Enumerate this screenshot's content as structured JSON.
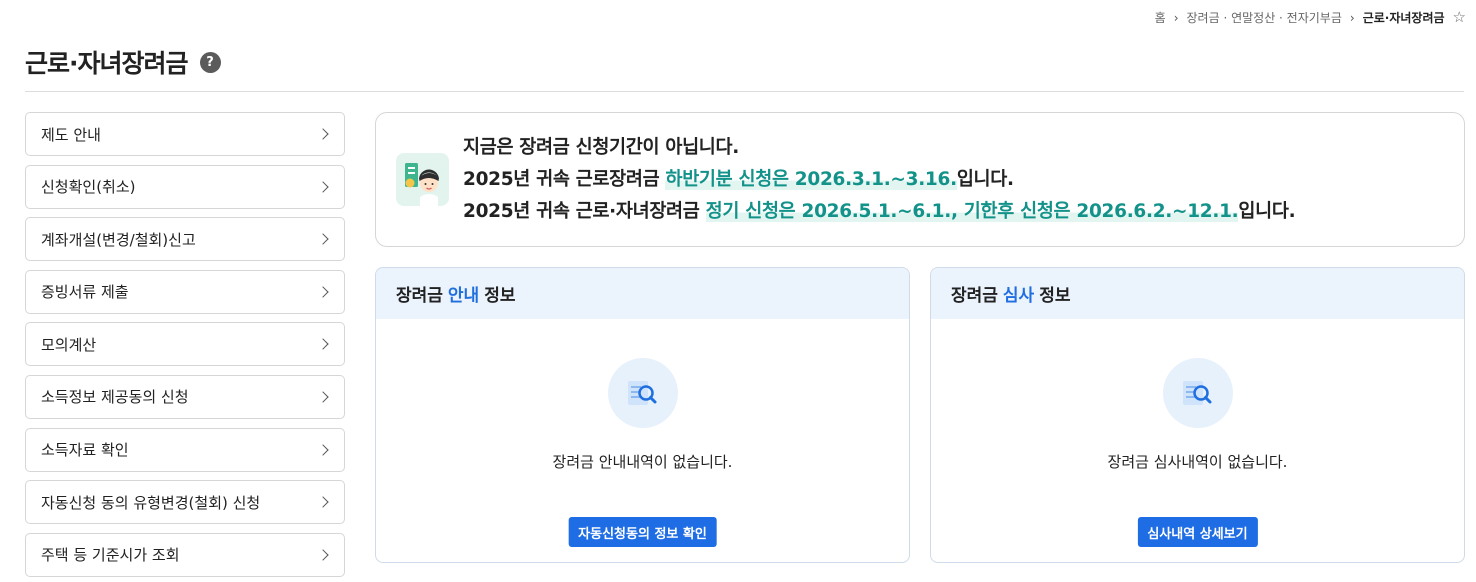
{
  "breadcrumb": {
    "home": "홈",
    "level1": "장려금 · 연말정산 · 전자기부금",
    "current": "근로·자녀장려금",
    "star_icon": "star-outline-icon"
  },
  "page": {
    "title": "근로·자녀장려금",
    "help_glyph": "?"
  },
  "sidebar": {
    "items": [
      {
        "label": "제도 안내"
      },
      {
        "label": "신청확인(취소)"
      },
      {
        "label": "계좌개설(변경/철회)신고"
      },
      {
        "label": "증빙서류 제출"
      },
      {
        "label": "모의계산"
      },
      {
        "label": "소득정보 제공동의 신청"
      },
      {
        "label": "소득자료 확인"
      },
      {
        "label": "자동신청 동의 유형변경(철회) 신청"
      },
      {
        "label": "주택 등 기준시가 조회"
      }
    ]
  },
  "notice": {
    "line1": "지금은 장려금 신청기간이 아닙니다.",
    "line2_prefix": "2025년 귀속 근로장려금 ",
    "line2_highlight": "하반기분 신청은 2026.3.1.~3.16.",
    "line2_suffix": "입니다.",
    "line3_prefix": "2025년 귀속 근로·자녀장려금 ",
    "line3_highlight": "정기 신청은 2026.5.1.~6.1., 기한후 신청은 2026.6.2.~12.1.",
    "line3_suffix": "입니다."
  },
  "panels": {
    "guide": {
      "title_prefix": "장려금",
      "title_accent": "안내",
      "title_suffix": "정보",
      "empty_text": "장려금 안내내역이 없습니다.",
      "button": "자동신청동의 정보 확인"
    },
    "review": {
      "title_prefix": "장려금",
      "title_accent": "심사",
      "title_suffix": "정보",
      "empty_text": "장려금 심사내역이 없습니다.",
      "button": "심사내역 상세보기"
    }
  },
  "colors": {
    "accent_blue": "#1e6de5",
    "highlight_teal": "#13928a",
    "panel_header_bg": "#ebf3fd"
  }
}
